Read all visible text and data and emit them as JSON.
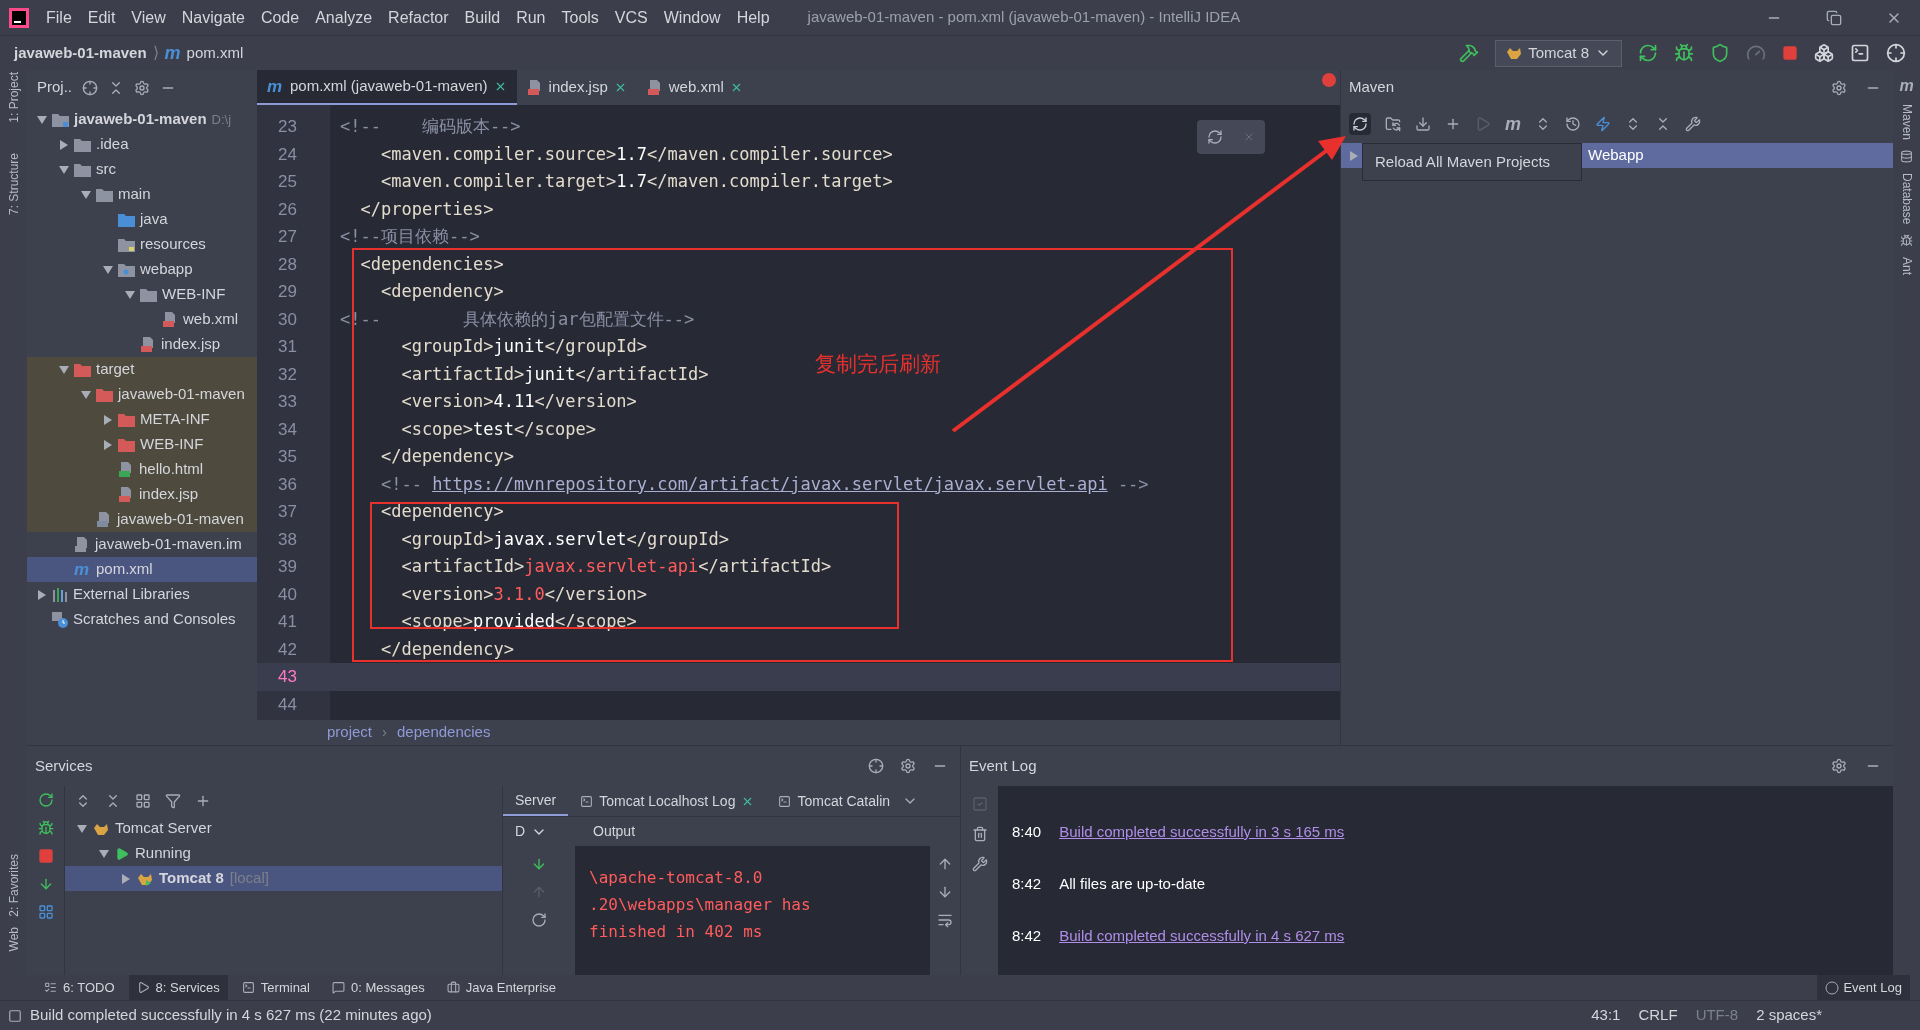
{
  "menu": [
    "File",
    "Edit",
    "View",
    "Navigate",
    "Code",
    "Analyze",
    "Refactor",
    "Build",
    "Run",
    "Tools",
    "VCS",
    "Window",
    "Help"
  ],
  "window": {
    "title": "javaweb-01-maven - pom.xml (javaweb-01-maven) - IntelliJ IDEA"
  },
  "nav": {
    "project": "javaweb-01-maven",
    "separator": "⟩",
    "file_icon": "m",
    "file": "pom.xml",
    "run_config": "Tomcat 8"
  },
  "stripes": {
    "left_top": [
      "1: Project",
      "7: Structure"
    ],
    "left_bottom": [
      "2: Favorites",
      "Web"
    ],
    "right_icon": "m",
    "right": [
      "Maven",
      "Database",
      "Ant"
    ]
  },
  "project": {
    "title": "Proj..",
    "tree": [
      {
        "label": "javaweb-01-maven",
        "path": "D:\\j",
        "kind": "module",
        "selected": false,
        "excluded": false,
        "expanded": true,
        "children": [
          {
            "label": ".idea",
            "kind": "folder",
            "selected": false,
            "excluded": false,
            "expanded": false
          },
          {
            "label": "src",
            "kind": "folder",
            "selected": false,
            "excluded": false,
            "expanded": true,
            "children": [
              {
                "label": "main",
                "kind": "folder",
                "selected": false,
                "excluded": false,
                "expanded": true,
                "children": [
                  {
                    "label": "java",
                    "kind": "source",
                    "selected": false,
                    "excluded": false
                  },
                  {
                    "label": "resources",
                    "kind": "resources",
                    "selected": false,
                    "excluded": false
                  },
                  {
                    "label": "webapp",
                    "kind": "web",
                    "selected": false,
                    "excluded": false,
                    "expanded": true,
                    "children": [
                      {
                        "label": "WEB-INF",
                        "kind": "folder",
                        "selected": false,
                        "excluded": false,
                        "expanded": true,
                        "children": [
                          {
                            "label": "web.xml",
                            "kind": "xml",
                            "selected": false,
                            "excluded": false
                          }
                        ]
                      },
                      {
                        "label": "index.jsp",
                        "kind": "jsp",
                        "selected": false,
                        "excluded": false
                      }
                    ]
                  }
                ]
              }
            ]
          },
          {
            "label": "target",
            "kind": "excluded_folder",
            "selected": false,
            "excluded": true,
            "expanded": true,
            "children": [
              {
                "label": "javaweb-01-maven",
                "kind": "excluded_folder",
                "selected": false,
                "excluded": true,
                "expanded": true,
                "children": [
                  {
                    "label": "META-INF",
                    "kind": "excluded_folder",
                    "selected": false,
                    "excluded": true,
                    "expanded": false
                  },
                  {
                    "label": "WEB-INF",
                    "kind": "excluded_folder",
                    "selected": false,
                    "excluded": true,
                    "expanded": false
                  },
                  {
                    "label": "hello.html",
                    "kind": "html",
                    "selected": false,
                    "excluded": true
                  },
                  {
                    "label": "index.jsp",
                    "kind": "jsp",
                    "selected": false,
                    "excluded": true
                  }
                ]
              },
              {
                "label": "javaweb-01-maven",
                "kind": "archive",
                "selected": false,
                "excluded": true
              }
            ]
          },
          {
            "label": "javaweb-01-maven.im",
            "kind": "iml",
            "selected": false,
            "excluded": false
          },
          {
            "label": "pom.xml",
            "kind": "maven",
            "icon_text": "m",
            "selected": true,
            "excluded": false
          }
        ]
      },
      {
        "label": "External Libraries",
        "kind": "libraries",
        "selected": false,
        "excluded": false,
        "expanded": false
      },
      {
        "label": "Scratches and Consoles",
        "kind": "scratches",
        "selected": false,
        "excluded": false
      }
    ]
  },
  "editor": {
    "tabs": [
      {
        "label": "pom.xml (javaweb-01-maven)",
        "kind": "maven",
        "icon_text": "m",
        "selected": true
      },
      {
        "label": "index.jsp",
        "kind": "jsp",
        "selected": false
      },
      {
        "label": "web.xml",
        "kind": "xml",
        "selected": false
      }
    ],
    "lines": [
      {
        "number": "23",
        "current": false,
        "tokens": [
          {
            "kind": "comment",
            "text": "<!--    编码版本-->"
          }
        ]
      },
      {
        "number": "24",
        "current": false,
        "tokens": [
          {
            "kind": "tag",
            "text": "    <maven.compiler.source>"
          },
          {
            "kind": "text",
            "text": "1.7"
          },
          {
            "kind": "tag",
            "text": "</maven.compiler.source>"
          }
        ]
      },
      {
        "number": "25",
        "current": false,
        "tokens": [
          {
            "kind": "tag",
            "text": "    <maven.compiler.target>"
          },
          {
            "kind": "text",
            "text": "1.7"
          },
          {
            "kind": "tag",
            "text": "</maven.compiler.target>"
          }
        ]
      },
      {
        "number": "26",
        "current": false,
        "tokens": [
          {
            "kind": "tag",
            "text": "  </properties>"
          }
        ]
      },
      {
        "number": "27",
        "current": false,
        "tokens": [
          {
            "kind": "comment",
            "text": "<!--项目依赖-->"
          }
        ]
      },
      {
        "number": "28",
        "current": false,
        "tokens": [
          {
            "kind": "tag",
            "text": "  <dependencies>"
          }
        ]
      },
      {
        "number": "29",
        "current": false,
        "tokens": [
          {
            "kind": "tag",
            "text": "    <dependency>"
          }
        ]
      },
      {
        "number": "30",
        "current": false,
        "tokens": [
          {
            "kind": "comment",
            "text": "<!--        具体依赖的jar包配置文件-->"
          }
        ]
      },
      {
        "number": "31",
        "current": false,
        "tokens": [
          {
            "kind": "tag",
            "text": "      <groupId>"
          },
          {
            "kind": "text",
            "text": "junit"
          },
          {
            "kind": "tag",
            "text": "</groupId>"
          }
        ]
      },
      {
        "number": "32",
        "current": false,
        "tokens": [
          {
            "kind": "tag",
            "text": "      <artifactId>"
          },
          {
            "kind": "text",
            "text": "junit"
          },
          {
            "kind": "tag",
            "text": "</artifactId>"
          }
        ]
      },
      {
        "number": "33",
        "current": false,
        "tokens": [
          {
            "kind": "tag",
            "text": "      <version>"
          },
          {
            "kind": "text",
            "text": "4.11"
          },
          {
            "kind": "tag",
            "text": "</version>"
          }
        ]
      },
      {
        "number": "34",
        "current": false,
        "tokens": [
          {
            "kind": "tag",
            "text": "      <scope>"
          },
          {
            "kind": "text",
            "text": "test"
          },
          {
            "kind": "tag",
            "text": "</scope>"
          }
        ]
      },
      {
        "number": "35",
        "current": false,
        "tokens": [
          {
            "kind": "tag",
            "text": "    </dependency>"
          }
        ]
      },
      {
        "number": "36",
        "current": false,
        "tokens": [
          {
            "kind": "comment",
            "text": "    <!-- "
          },
          {
            "kind": "link",
            "text": "https://mvnrepository.com/artifact/javax.servlet/javax.servlet-api"
          },
          {
            "kind": "comment",
            "text": " -->"
          }
        ]
      },
      {
        "number": "37",
        "current": false,
        "tokens": [
          {
            "kind": "tag",
            "text": "    <dependency>"
          }
        ]
      },
      {
        "number": "38",
        "current": false,
        "tokens": [
          {
            "kind": "tag",
            "text": "      <groupId>"
          },
          {
            "kind": "text",
            "text": "javax.servlet"
          },
          {
            "kind": "tag",
            "text": "</groupId>"
          }
        ]
      },
      {
        "number": "39",
        "current": false,
        "tokens": [
          {
            "kind": "tag",
            "text": "      <artifactId>"
          },
          {
            "kind": "error",
            "text": "javax.servlet-api"
          },
          {
            "kind": "tag",
            "text": "</artifactId>"
          }
        ]
      },
      {
        "number": "40",
        "current": false,
        "tokens": [
          {
            "kind": "tag",
            "text": "      <version>"
          },
          {
            "kind": "error",
            "text": "3.1.0"
          },
          {
            "kind": "tag",
            "text": "</version>"
          }
        ]
      },
      {
        "number": "41",
        "current": false,
        "tokens": [
          {
            "kind": "tag",
            "text": "      <scope>"
          },
          {
            "kind": "text",
            "text": "provided"
          },
          {
            "kind": "tag",
            "text": "</scope>"
          }
        ]
      },
      {
        "number": "42",
        "current": false,
        "tokens": [
          {
            "kind": "tag",
            "text": "    </dependency>"
          }
        ]
      },
      {
        "number": "43",
        "current": true
      },
      {
        "number": "44",
        "current": false
      }
    ],
    "breadcrumb": {
      "items": [
        "project",
        "dependencies"
      ],
      "separator": "›"
    },
    "annotation": {
      "text": "复制完后刷新"
    }
  },
  "maven": {
    "title": "Maven",
    "toolbar_m": "m",
    "tree": [
      {
        "label": "Webapp",
        "selected": true,
        "expanded": false
      }
    ],
    "tooltip": "Reload All Maven Projects"
  },
  "services": {
    "title": "Services",
    "tree": [
      {
        "label": "Tomcat Server",
        "kind": "server",
        "selected": false,
        "expanded": true,
        "children": [
          {
            "label": "Running",
            "kind": "running",
            "selected": false,
            "expanded": true,
            "children": [
              {
                "label": "Tomcat 8",
                "suffix": "[local]",
                "kind": "tomcat",
                "selected": true,
                "expanded": false
              }
            ]
          }
        ]
      }
    ],
    "tabs": [
      {
        "label": "Server",
        "selected": true,
        "closable": false
      },
      {
        "label": "Tomcat Localhost Log",
        "selected": false,
        "closable": true
      },
      {
        "label": "Tomcat Catalin",
        "selected": false,
        "closable": false
      }
    ],
    "subheader": {
      "dropdown": "D",
      "title": "Output"
    },
    "output": [
      "\\apache-tomcat-8.0",
      ".20\\webapps\\manager has",
      "finished in 402 ms"
    ]
  },
  "event_log": {
    "title": "Event Log",
    "entries": [
      {
        "time": "8:40",
        "text": "Build completed successfully in 3 s 165 ms",
        "link": true
      },
      {
        "time": "8:42",
        "text": "All files are up-to-date",
        "link": false
      },
      {
        "time": "8:42",
        "text": "Build completed successfully in 4 s 627 ms",
        "link": true
      }
    ]
  },
  "toolwindows": [
    {
      "label": "6: TODO",
      "selected": false
    },
    {
      "label": "8: Services",
      "selected": true
    },
    {
      "label": "Terminal",
      "selected": false
    },
    {
      "label": "0: Messages",
      "selected": false
    },
    {
      "label": "Java Enterprise",
      "selected": false
    }
  ],
  "toolwindows_right": "Event Log",
  "status": {
    "message": "Build completed successfully in 4 s 627 ms (22 minutes ago)",
    "items": [
      {
        "text": "43:1",
        "dim": false
      },
      {
        "text": "CRLF",
        "dim": false
      },
      {
        "text": "UTF-8",
        "dim": true
      },
      {
        "text": "2 spaces*",
        "dim": false
      }
    ]
  }
}
